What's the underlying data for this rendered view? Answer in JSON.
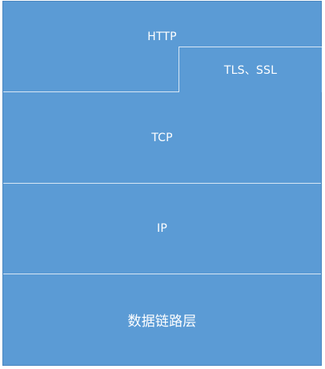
{
  "colors": {
    "layer_fill": "#5b9bd5",
    "divider": "#d7e6f4",
    "text": "#ffffff"
  },
  "layers": {
    "http": "HTTP",
    "tls_ssl": "TLS、SSL",
    "tcp": "TCP",
    "ip": "IP",
    "data_link": "数据链路层"
  }
}
